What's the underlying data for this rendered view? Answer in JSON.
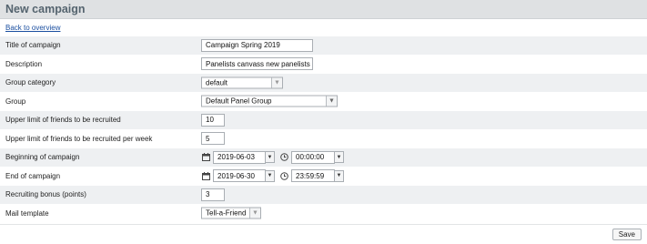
{
  "page_title": "New campaign",
  "back_link": "Back to overview",
  "fields": {
    "title": {
      "label": "Title of campaign",
      "value": "Campaign Spring 2019"
    },
    "description": {
      "label": "Description",
      "value": "Panelists canvass new panelists"
    },
    "group_category": {
      "label": "Group category",
      "value": "default"
    },
    "group": {
      "label": "Group",
      "value": "Default Panel Group"
    },
    "upper_limit": {
      "label": "Upper limit of friends to be recruited",
      "value": "10"
    },
    "upper_limit_week": {
      "label": "Upper limit of friends to be recruited per week",
      "value": "5"
    },
    "beginning": {
      "label": "Beginning of campaign",
      "date": "2019-06-03",
      "time": "00:00:00"
    },
    "end": {
      "label": "End of campaign",
      "date": "2019-06-30",
      "time": "23:59:59"
    },
    "bonus": {
      "label": "Recruiting bonus (points)",
      "value": "3"
    },
    "mail_template": {
      "label": "Mail template",
      "value": "Tell-a-Friend"
    }
  },
  "save_label": "Save",
  "icons": {
    "calendar": "calendar-icon",
    "clock": "clock-icon",
    "dropdown": "chevron-down-icon"
  }
}
